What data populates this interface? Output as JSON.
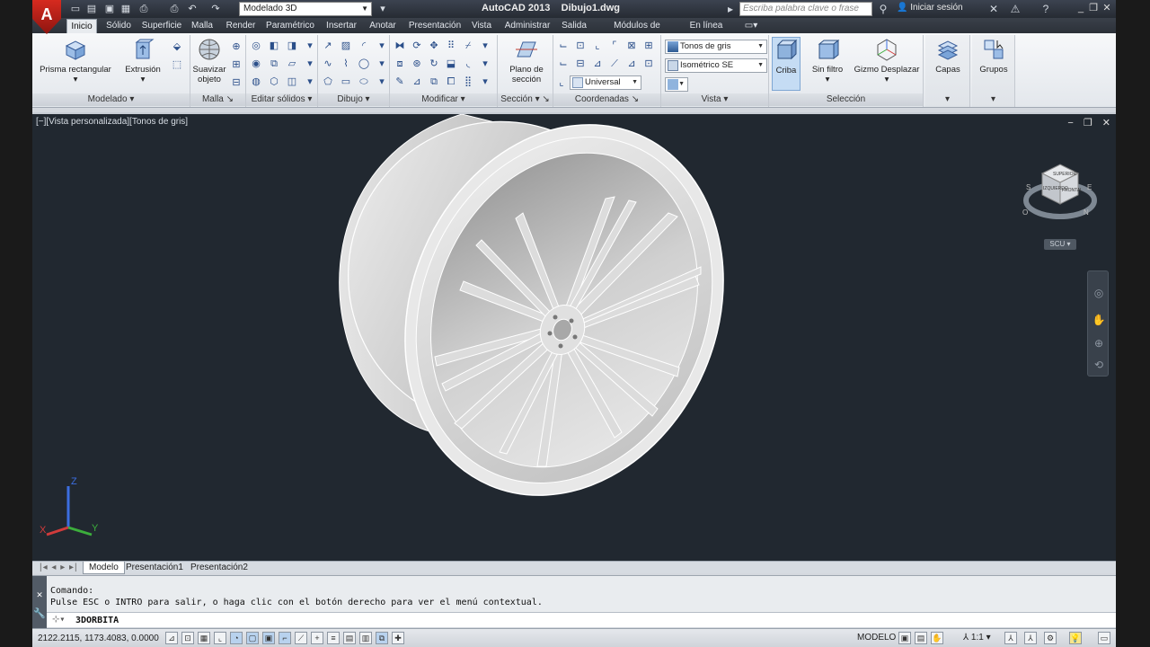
{
  "app": {
    "logo_letter": "A",
    "title": "AutoCAD 2013    Dibujo1.dwg",
    "workspace": "Modelado 3D",
    "search_placeholder": "Escriba palabra clave o frase",
    "signin": "Iniciar sesión"
  },
  "tabs": [
    {
      "label": "Inicio"
    },
    {
      "label": "Sólido"
    },
    {
      "label": "Superficie"
    },
    {
      "label": "Malla"
    },
    {
      "label": "Render"
    },
    {
      "label": "Paramétrico"
    },
    {
      "label": "Insertar"
    },
    {
      "label": "Anotar"
    },
    {
      "label": "Presentación"
    },
    {
      "label": "Vista"
    },
    {
      "label": "Administrar"
    },
    {
      "label": "Salida"
    },
    {
      "label": "Módulos de extensión"
    },
    {
      "label": "En línea"
    }
  ],
  "ribbon": {
    "modelado": {
      "title": "Modelado",
      "prisma": "Prisma rectangular",
      "extrusion": "Extrusión"
    },
    "malla": {
      "title": "Malla",
      "suavizar": "Suavizar objeto"
    },
    "editar_solidos": {
      "title": "Editar sólidos"
    },
    "dibujo": {
      "title": "Dibujo"
    },
    "modificar": {
      "title": "Modificar"
    },
    "seccion": {
      "title": "Sección",
      "plano": "Plano de sección"
    },
    "coordenadas": {
      "title": "Coordenadas",
      "universal": "Universal"
    },
    "vista": {
      "title": "Vista",
      "visual_style": "Tonos de gris",
      "view": "Isométrico SE"
    },
    "seleccion": {
      "title": "Selección",
      "criba": "Criba",
      "sin_filtro": "Sin filtro",
      "gizmo": "Gizmo Desplazar"
    },
    "capas": {
      "label": "Capas"
    },
    "grupos": {
      "label": "Grupos"
    }
  },
  "viewport": {
    "label": "[−][Vista personalizada][Tonos de gris]",
    "ucs_button": "SCU",
    "viewcube": {
      "front": "FRONTAL",
      "left": "IZQUIERDO",
      "top": "SUPERIOR"
    },
    "axis_labels": {
      "x": "X",
      "y": "Y",
      "z": "Z"
    },
    "compass": {
      "north": "N",
      "south": "S",
      "east": "E",
      "west": "O"
    }
  },
  "layout_tabs": [
    {
      "label": "Modelo"
    },
    {
      "label": "Presentación1"
    },
    {
      "label": "Presentación2"
    }
  ],
  "command": {
    "history_1": "Comando:",
    "history_2": "Pulse ESC o INTRO para salir, o haga clic con el botón derecho para ver el menú contextual.",
    "current": "3DORBITA"
  },
  "status": {
    "coords": "2122.2115, 1173.4083, 0.0000",
    "model": "MODELO",
    "scale": "1:1"
  },
  "colors": {
    "viewport_bg": "#212830",
    "accent_red": "#d62a1f",
    "axis_x": "#d13b3b",
    "axis_y": "#3cae3c",
    "axis_z": "#3c6ee0"
  }
}
